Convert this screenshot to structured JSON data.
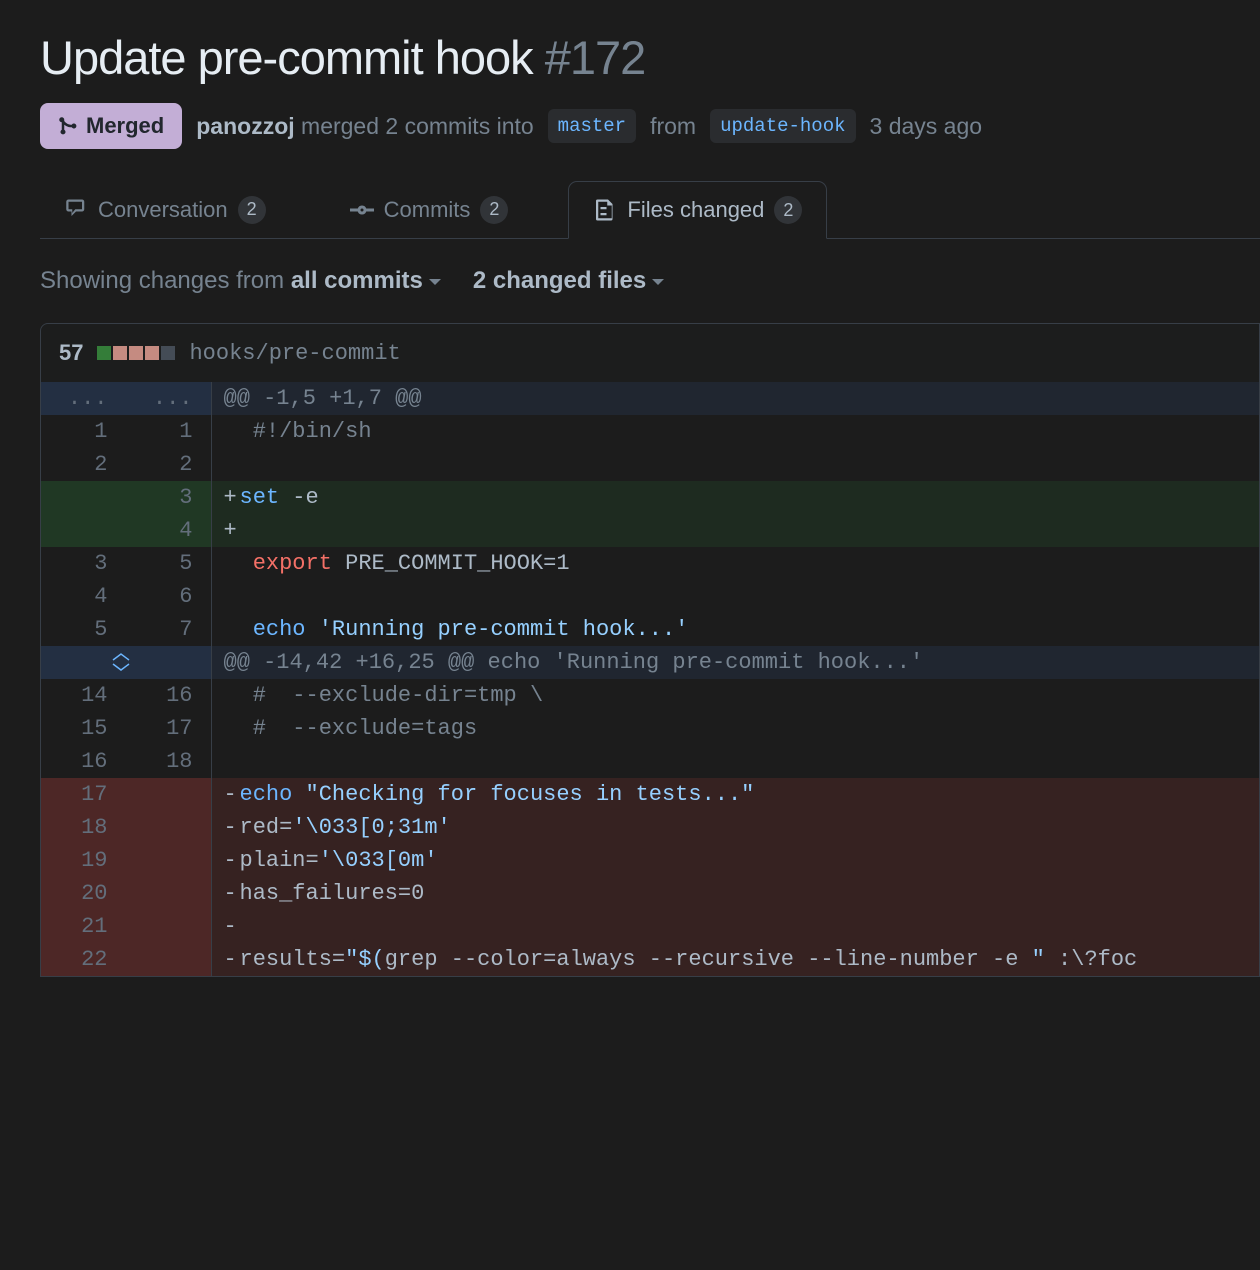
{
  "pr": {
    "title": "Update pre-commit hook",
    "number": "#172",
    "state_label": "Merged",
    "author": "panozzoj",
    "merged_verb": "merged 2 commits into",
    "base_branch": "master",
    "from_word": "from",
    "head_branch": "update-hook",
    "when": "3 days ago"
  },
  "tabs": {
    "conversation": {
      "label": "Conversation",
      "count": "2"
    },
    "commits": {
      "label": "Commits",
      "count": "2"
    },
    "files": {
      "label": "Files changed",
      "count": "2"
    }
  },
  "toolbar": {
    "prefix": "Showing changes from ",
    "all_commits": "all commits",
    "changed_files": "2 changed files"
  },
  "file": {
    "stat": "57",
    "path": "hooks/pre-commit",
    "diffstat": [
      "add",
      "del",
      "del",
      "del",
      "neu"
    ]
  },
  "diff": {
    "hunks": [
      {
        "ln1": "...",
        "ln2": "...",
        "header": "@@ -1,5 +1,7 @@",
        "lines": [
          {
            "type": "ctx",
            "ln1": "1",
            "ln2": "1",
            "marker": " ",
            "segs": [
              {
                "t": " ",
                "c": ""
              },
              {
                "t": "#!/bin/sh",
                "c": "comment"
              }
            ]
          },
          {
            "type": "ctx",
            "ln1": "2",
            "ln2": "2",
            "marker": " ",
            "segs": []
          },
          {
            "type": "add",
            "ln1": "",
            "ln2": "3",
            "marker": "+",
            "segs": [
              {
                "t": "set",
                "c": "kw2"
              },
              {
                "t": " -e",
                "c": ""
              }
            ]
          },
          {
            "type": "add",
            "ln1": "",
            "ln2": "4",
            "marker": "+",
            "segs": []
          },
          {
            "type": "ctx",
            "ln1": "3",
            "ln2": "5",
            "marker": " ",
            "segs": [
              {
                "t": " ",
                "c": ""
              },
              {
                "t": "export",
                "c": "kw"
              },
              {
                "t": " PRE_COMMIT_HOOK=1",
                "c": ""
              }
            ]
          },
          {
            "type": "ctx",
            "ln1": "4",
            "ln2": "6",
            "marker": " ",
            "segs": []
          },
          {
            "type": "ctx",
            "ln1": "5",
            "ln2": "7",
            "marker": " ",
            "segs": [
              {
                "t": " ",
                "c": ""
              },
              {
                "t": "echo",
                "c": "kw2"
              },
              {
                "t": " ",
                "c": ""
              },
              {
                "t": "'Running pre-commit hook...'",
                "c": "str"
              }
            ]
          }
        ]
      },
      {
        "ln1": "expand",
        "ln2": "",
        "header": "@@ -14,42 +16,25 @@ echo 'Running pre-commit hook...'",
        "lines": [
          {
            "type": "ctx",
            "ln1": "14",
            "ln2": "16",
            "marker": " ",
            "segs": [
              {
                "t": " ",
                "c": ""
              },
              {
                "t": "#  --exclude-dir=tmp \\",
                "c": "comment"
              }
            ]
          },
          {
            "type": "ctx",
            "ln1": "15",
            "ln2": "17",
            "marker": " ",
            "segs": [
              {
                "t": " ",
                "c": ""
              },
              {
                "t": "#  --exclude=tags",
                "c": "comment"
              }
            ]
          },
          {
            "type": "ctx",
            "ln1": "16",
            "ln2": "18",
            "marker": " ",
            "segs": []
          },
          {
            "type": "del",
            "ln1": "17",
            "ln2": "",
            "marker": "-",
            "segs": [
              {
                "t": "echo",
                "c": "kw2"
              },
              {
                "t": " ",
                "c": ""
              },
              {
                "t": "\"Checking for focuses in tests...\"",
                "c": "str"
              }
            ]
          },
          {
            "type": "del",
            "ln1": "18",
            "ln2": "",
            "marker": "-",
            "segs": [
              {
                "t": "red=",
                "c": ""
              },
              {
                "t": "'\\033[0;31m'",
                "c": "str"
              }
            ]
          },
          {
            "type": "del",
            "ln1": "19",
            "ln2": "",
            "marker": "-",
            "segs": [
              {
                "t": "plain=",
                "c": ""
              },
              {
                "t": "'\\033[0m'",
                "c": "str"
              }
            ]
          },
          {
            "type": "del",
            "ln1": "20",
            "ln2": "",
            "marker": "-",
            "segs": [
              {
                "t": "has_failures=0",
                "c": ""
              }
            ]
          },
          {
            "type": "del",
            "ln1": "21",
            "ln2": "",
            "marker": "-",
            "segs": []
          },
          {
            "type": "del",
            "ln1": "22",
            "ln2": "",
            "marker": "-",
            "segs": [
              {
                "t": "results=",
                "c": ""
              },
              {
                "t": "\"$(",
                "c": "str"
              },
              {
                "t": "grep --color=always --recursive --line-number -e ",
                "c": ""
              },
              {
                "t": "\"",
                "c": "str"
              },
              {
                "t": " :\\?foc",
                "c": ""
              }
            ]
          }
        ]
      }
    ]
  }
}
